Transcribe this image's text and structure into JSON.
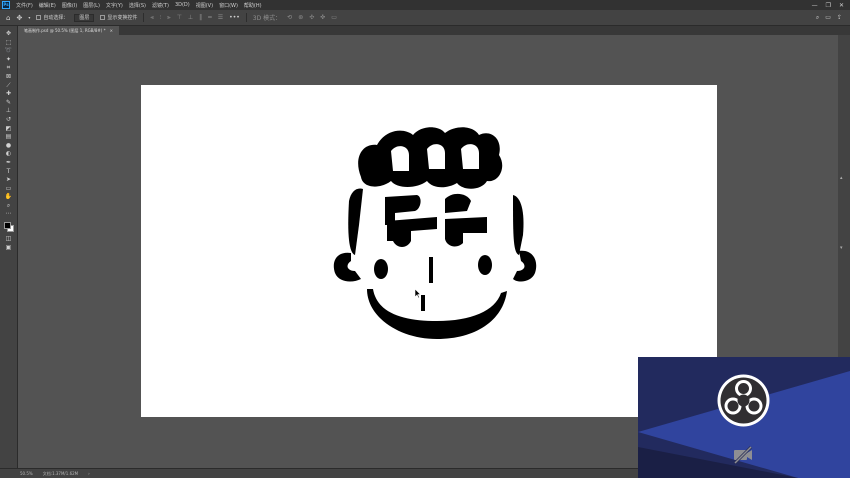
{
  "app": {
    "logo_text": "Ps"
  },
  "menu": {
    "items": [
      "文件(F)",
      "编辑(E)",
      "图像(I)",
      "图层(L)",
      "文字(Y)",
      "选择(S)",
      "滤镜(T)",
      "3D(D)",
      "视图(V)",
      "窗口(W)",
      "帮助(H)"
    ],
    "window_controls": [
      "—",
      "❐",
      "✕"
    ]
  },
  "options": {
    "auto_select_label": "自动选择：",
    "auto_select_value": "图层",
    "show_transform_label": "显示变换控件",
    "more_label": "•••",
    "mode_3d_label": "3D 模式："
  },
  "document": {
    "tab_title": "笔画制作.psd @ 50.5% (图层 1, RGB/8#) *",
    "tab_close": "×"
  },
  "status": {
    "zoom": "50.5%",
    "size": "文档:1.37M/1.62M",
    "arrow": "›"
  },
  "colors": {
    "foreground": "#000000",
    "background": "#ffffff",
    "obs_bg_dark": "#222a5e",
    "obs_bg_light": "#30449e"
  },
  "icons": {
    "overlay_logo": "obs-logo-icon",
    "overlay_camera": "camera-off-icon"
  }
}
